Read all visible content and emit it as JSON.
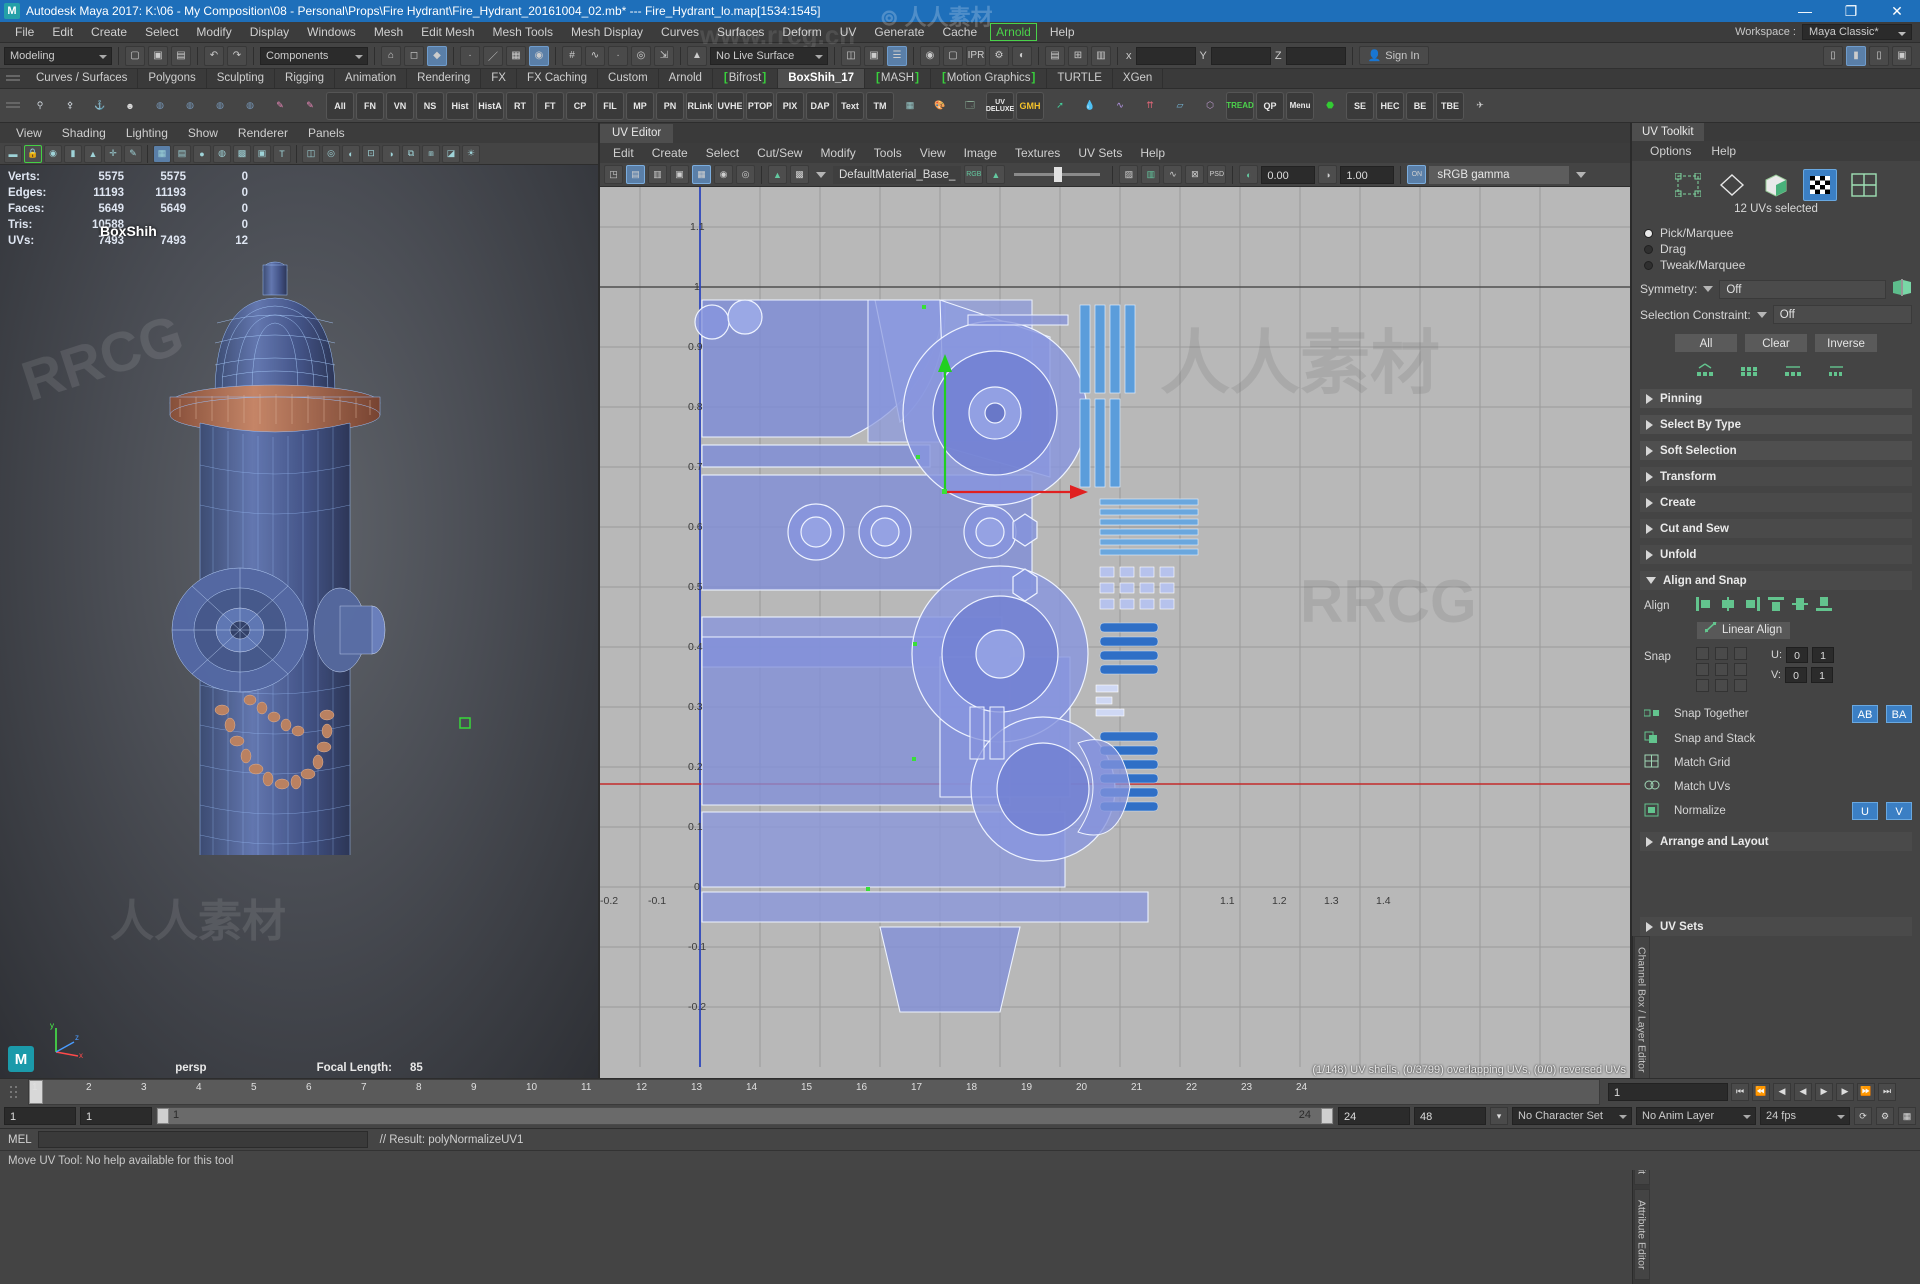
{
  "titlebar": {
    "logo": "M",
    "title": "Autodesk Maya 2017: K:\\06 - My Composition\\08 - Personal\\Props\\Fire Hydrant\\Fire_Hydrant_20161004_02.mb*   ---   Fire_Hydrant_lo.map[1534:1545]",
    "minimize": "—",
    "maximize": "❐",
    "close": "✕"
  },
  "menubar": {
    "items": [
      "File",
      "Edit",
      "Create",
      "Select",
      "Modify",
      "Display",
      "Windows",
      "Mesh",
      "Edit Mesh",
      "Mesh Tools",
      "Mesh Display",
      "Curves",
      "Surfaces",
      "Deform",
      "UV",
      "Generate",
      "Cache"
    ],
    "arnold": "Arnold",
    "help": "Help",
    "workspace_label": "Workspace :",
    "workspace_value": "Maya Classic*"
  },
  "statusline": {
    "mode": "Modeling",
    "selection_mask": "Components",
    "live_surface": "No Live Surface",
    "coord_x": "x",
    "coord_y": "Y",
    "coord_z": "Z",
    "signin": "Sign In"
  },
  "shelf": {
    "tabs": [
      {
        "label": "Curves / Surfaces",
        "active": false,
        "bracket": false
      },
      {
        "label": "Polygons",
        "active": false,
        "bracket": false
      },
      {
        "label": "Sculpting",
        "active": false,
        "bracket": false
      },
      {
        "label": "Rigging",
        "active": false,
        "bracket": false
      },
      {
        "label": "Animation",
        "active": false,
        "bracket": false
      },
      {
        "label": "Rendering",
        "active": false,
        "bracket": false
      },
      {
        "label": "FX",
        "active": false,
        "bracket": false
      },
      {
        "label": "FX Caching",
        "active": false,
        "bracket": false
      },
      {
        "label": "Custom",
        "active": false,
        "bracket": false
      },
      {
        "label": "Arnold",
        "active": false,
        "bracket": false
      },
      {
        "label": "Bifrost",
        "active": false,
        "bracket": true
      },
      {
        "label": "BoxShih_17",
        "active": true,
        "bracket": false
      },
      {
        "label": "MASH",
        "active": false,
        "bracket": true
      },
      {
        "label": "Motion Graphics",
        "active": false,
        "bracket": true
      },
      {
        "label": "TURTLE",
        "active": false,
        "bracket": false
      },
      {
        "label": "XGen",
        "active": false,
        "bracket": false
      }
    ],
    "icon_labels": [
      "All",
      "FN",
      "VN",
      "NS",
      "Hist",
      "HistA",
      "RT",
      "FT",
      "CP",
      "FIL",
      "MP",
      "PN",
      "RLink",
      "UVHE",
      "PTOP",
      "PIX",
      "DAP",
      "Text",
      "TM"
    ],
    "icon_labels_right": [
      "UV DELUXE",
      "GMH",
      "TREAD",
      "Menu",
      "SE",
      "HEC",
      "BE",
      "TBE"
    ],
    "qp_label": "QP"
  },
  "viewport": {
    "menus": [
      "View",
      "Shading",
      "Lighting",
      "Show",
      "Renderer",
      "Panels"
    ],
    "hud": {
      "rows": [
        {
          "label": "Verts:",
          "a": "5575",
          "b": "5575",
          "c": "0"
        },
        {
          "label": "Edges:",
          "a": "11193",
          "b": "11193",
          "c": "0"
        },
        {
          "label": "Faces:",
          "a": "5649",
          "b": "5649",
          "c": "0"
        },
        {
          "label": "Tris:",
          "a": "10588",
          "b": "",
          "c": "0"
        },
        {
          "label": "UVs:",
          "a": "7493",
          "b": "7493",
          "c": "12"
        }
      ]
    },
    "object_name": "BoxShih",
    "camera": "persp",
    "focal_label": "Focal Length:",
    "focal_value": "85",
    "axis": {
      "x": "x",
      "y": "y",
      "z": "z"
    }
  },
  "uv_editor": {
    "tab": "UV Editor",
    "menus": [
      "Edit",
      "Create",
      "Select",
      "Cut/Sew",
      "Modify",
      "Tools",
      "View",
      "Image",
      "Textures",
      "UV Sets",
      "Help"
    ],
    "material": "DefaultMaterial_Base_",
    "rgb_label": "RGB",
    "field_a": "0.00",
    "field_b": "1.00",
    "gamma": "sRGB gamma",
    "status": "(1/148) UV shells, (0/3799) overlapping UVs, (0/0) reversed UVs",
    "axis_labels": {
      "x": [
        "-0.2",
        "-0.1",
        "",
        "1.1",
        "1.2",
        "1.3",
        "1.4"
      ],
      "y": [
        "1.1",
        "1",
        "0.9",
        "0.8",
        "0.7",
        "0.6",
        "0.5",
        "0.4",
        "0.3",
        "0.2",
        "0.1",
        "0",
        "-0.1",
        "-0.2"
      ]
    }
  },
  "uv_toolkit": {
    "title": "UV Toolkit",
    "menus": [
      "Options",
      "Help"
    ],
    "mode_icons": [
      "uv-shell-icon",
      "uv-vertex-icon",
      "uv-face-icon",
      "uv-selected-icon",
      "uv-grid-icon"
    ],
    "selection_count": "12 UVs selected",
    "radios": [
      {
        "label": "Pick/Marquee",
        "on": true
      },
      {
        "label": "Drag",
        "on": false
      },
      {
        "label": "Tweak/Marquee",
        "on": false
      }
    ],
    "symmetry_label": "Symmetry:",
    "symmetry_value": "Off",
    "constraint_label": "Selection Constraint:",
    "constraint_value": "Off",
    "buttons": [
      "All",
      "Clear",
      "Inverse"
    ],
    "sections": [
      "Pinning",
      "Select By Type",
      "Soft Selection",
      "Transform",
      "Create",
      "Cut and Sew",
      "Unfold"
    ],
    "align_section": "Align and Snap",
    "align_label": "Align",
    "linear_align": "Linear Align",
    "snap_label": "Snap",
    "u_label": "U:",
    "v_label": "V:",
    "u_a": "0",
    "u_b": "1",
    "v_a": "0",
    "v_b": "1",
    "snap_together": "Snap Together",
    "snap_ab": "AB",
    "snap_ba": "BA",
    "snap_stack": "Snap and Stack",
    "match_grid": "Match Grid",
    "match_uvs": "Match UVs",
    "normalize": "Normalize",
    "norm_u": "U",
    "norm_v": "V",
    "arrange": "Arrange and Layout",
    "uv_sets": "UV Sets",
    "dock_tabs": [
      "Channel Box / Layer Editor",
      "Modeling Toolkit",
      "Attribute Editor"
    ]
  },
  "timeline": {
    "ticks": [
      "1",
      "2",
      "3",
      "4",
      "5",
      "6",
      "7",
      "8",
      "9",
      "10",
      "11",
      "12",
      "13",
      "14",
      "15",
      "16",
      "17",
      "18",
      "19",
      "20",
      "21",
      "22",
      "23",
      "24"
    ],
    "current_frame": "1",
    "range_start": "1",
    "range_end": "1",
    "range_field_start": "1",
    "range_display_end": "24",
    "anim_start": "24",
    "anim_end": "48",
    "character_set": "No Character Set",
    "anim_layer": "No Anim Layer",
    "fps": "24 fps",
    "current_time": "1"
  },
  "statusbar": {
    "mel_label": "MEL",
    "result": "// Result: polyNormalizeUV1",
    "help": "Move UV Tool: No help available for this tool"
  },
  "colors": {
    "title_blue": "#1e6fba",
    "accent_blue": "#3b7fc4",
    "green": "#38d13c",
    "panel": "#444444"
  }
}
